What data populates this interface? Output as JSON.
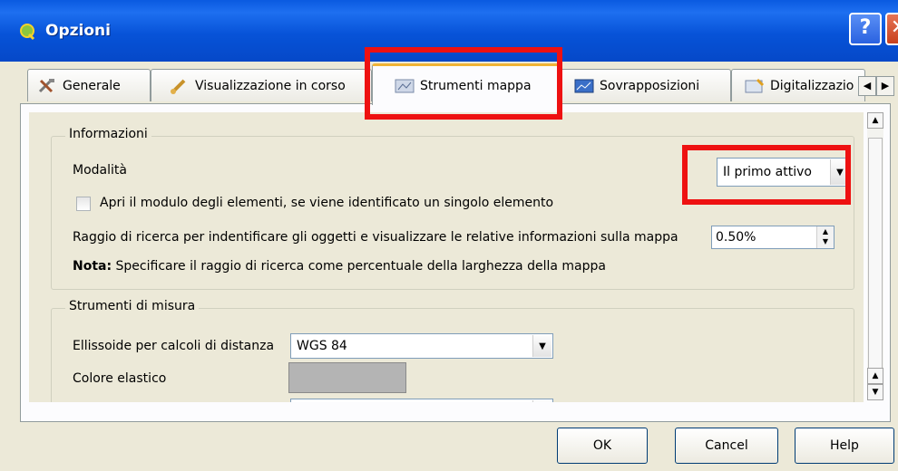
{
  "window": {
    "title": "Opzioni",
    "help_symbol": "?",
    "close_symbol": "✕"
  },
  "tabs": [
    {
      "label": "Generale",
      "icon": "tools-icon"
    },
    {
      "label": "Visualizzazione in corso",
      "icon": "brush-icon"
    },
    {
      "label": "Strumenti mappa",
      "icon": "map-tools-icon",
      "active": true
    },
    {
      "label": "Sovrapposizioni",
      "icon": "overlay-icon"
    },
    {
      "label": "Digitalizzazio",
      "icon": "digitize-icon"
    }
  ],
  "informazioni": {
    "title": "Informazioni",
    "mode_label": "Modalità",
    "mode_value": "Il primo attivo",
    "open_form_label": "Apri il modulo degli elementi, se viene identificato un singolo elemento",
    "open_form_checked": false,
    "search_radius_label": "Raggio di ricerca per indentificare gli oggetti e visualizzare le relative informazioni sulla mappa",
    "search_radius_value": "0.50%",
    "note_bold": "Nota:",
    "note_text": " Specificare il raggio di ricerca come percentuale della larghezza della mappa"
  },
  "misura": {
    "title": "Strumenti di misura",
    "ellipsoid_label": "Ellissoide per calcoli di distanza",
    "ellipsoid_value": "WGS 84",
    "rubber_color_label": "Colore elastico",
    "rubber_color": "#b4b4b4"
  },
  "buttons": {
    "ok": "OK",
    "cancel": "Cancel",
    "help": "Help"
  },
  "colors": {
    "titlebar": "#0753D8",
    "highlight": "#ee1111",
    "dialog_bg": "#ECE9D8"
  }
}
